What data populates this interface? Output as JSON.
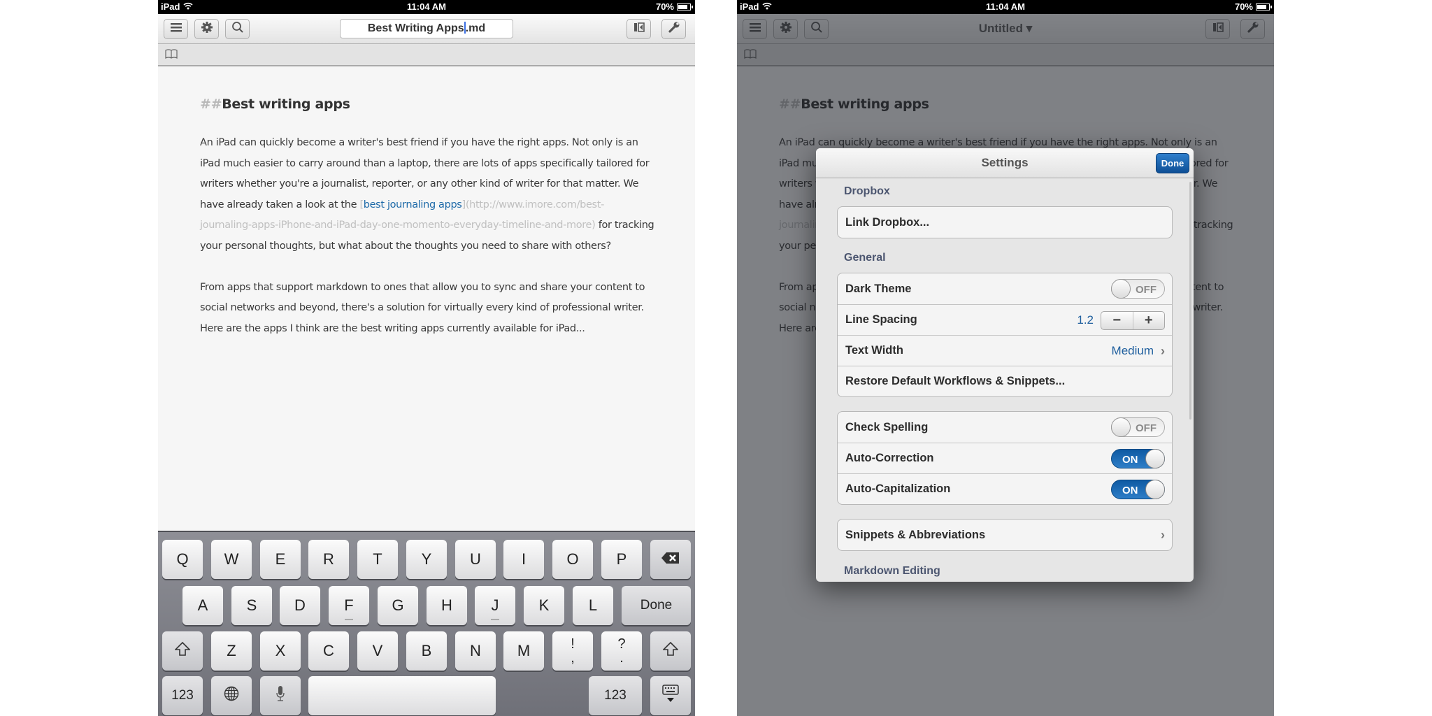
{
  "status_bar": {
    "device": "iPad",
    "time": "11:04 AM",
    "battery": "70%",
    "wifi_icon": "wifi-icon",
    "battery_icon": "battery-icon"
  },
  "left_screen": {
    "toolbar": {
      "left_buttons": [
        {
          "name": "menu",
          "icon": "hamburger-icon"
        },
        {
          "name": "settings",
          "icon": "gear-icon"
        },
        {
          "name": "search",
          "icon": "search-icon"
        }
      ],
      "title_field_value_before_caret": "Best Writing Apps",
      "title_field_value_after_caret": ".md",
      "right_buttons": [
        {
          "name": "sidebar",
          "icon": "sidebar-collapse-icon"
        },
        {
          "name": "tools",
          "icon": "wrench-icon"
        }
      ]
    },
    "subbar": {
      "icon": "book-icon"
    },
    "document": {
      "heading_marker": "##",
      "heading": "Best writing apps",
      "para1_before_link": "An iPad can quickly become a writer's best friend if you have the right apps. Not only is an iPad much easier to  carry around than a laptop, there are lots of apps specifically tailored for writers whether you're a journalist, reporter, or any other kind of writer for that matter. We have already taken a look at the ",
      "link_open": "[",
      "link_text": "best journaling apps",
      "link_close": "]",
      "link_url": "(http://www.imore.com/best-journaling-apps-iPhone-and-iPad-day-one-momento-everyday-timeline-and-more)",
      "para1_after_link": " for tracking your personal thoughts, but what about the thoughts you need to share with others?",
      "para2": "From apps that support markdown to ones that allow you to sync and share your content to social networks and beyond, there's a solution for virtually every kind of professional writer. Here are the apps I think are the best writing apps currently available for iPad..."
    },
    "keyboard": {
      "row1": [
        "Q",
        "W",
        "E",
        "R",
        "T",
        "Y",
        "U",
        "I",
        "O",
        "P"
      ],
      "backspace_icon": "backspace-icon",
      "row2": [
        "A",
        "S",
        "D",
        "F",
        "G",
        "H",
        "J",
        "K",
        "L"
      ],
      "done_label": "Done",
      "shift_icon": "shift-icon",
      "row3": [
        "Z",
        "X",
        "C",
        "V",
        "B",
        "N",
        "M"
      ],
      "punct1_top": "!",
      "punct1_bottom": ",",
      "punct2_top": "?",
      "punct2_bottom": ".",
      "numbers_label": "123",
      "globe_icon": "globe-icon",
      "mic_icon": "microphone-icon",
      "hide_keyboard_icon": "hide-keyboard-icon"
    }
  },
  "right_screen": {
    "toolbar": {
      "title": "Untitled ▾"
    },
    "settings": {
      "title": "Settings",
      "done_label": "Done",
      "sections": {
        "dropbox": {
          "label": "Dropbox",
          "link_dropbox": "Link Dropbox..."
        },
        "general": {
          "label": "General",
          "dark_theme": {
            "label": "Dark Theme",
            "state": "OFF"
          },
          "line_spacing": {
            "label": "Line Spacing",
            "value": "1.2",
            "minus": "−",
            "plus": "+"
          },
          "text_width": {
            "label": "Text Width",
            "value": "Medium"
          },
          "restore": "Restore Default Workflows & Snippets..."
        },
        "typing": {
          "check_spelling": {
            "label": "Check Spelling",
            "state": "OFF"
          },
          "auto_correction": {
            "label": "Auto-Correction",
            "state": "ON"
          },
          "auto_capitalization": {
            "label": "Auto-Capitalization",
            "state": "ON"
          }
        },
        "snippets": {
          "label": "Snippets & Abbreviations"
        },
        "markdown_editing": {
          "label": "Markdown Editing"
        }
      }
    }
  },
  "colors": {
    "accent_blue": "#1f5f9e",
    "done_button": "#1a64b0",
    "section_label": "#4c5670",
    "caret": "#3b6fe3"
  }
}
